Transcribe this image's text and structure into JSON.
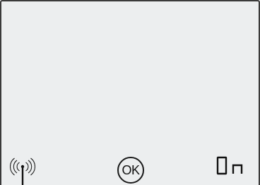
{
  "display": {
    "status_text": "On"
  },
  "controls": {
    "ok_label": "OK"
  },
  "icons": {
    "signal": "wireless-signal-icon",
    "confirm": "ok-button-icon"
  },
  "colors": {
    "screen_background": "#eceeef",
    "bezel": "#3a3a3a",
    "ink": "#111111"
  }
}
